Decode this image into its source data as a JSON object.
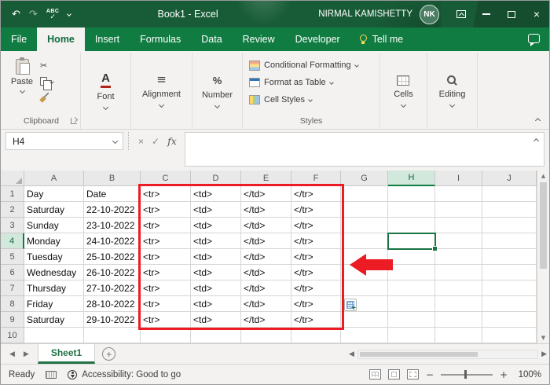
{
  "titlebar": {
    "title": "Book1 - Excel",
    "user_name": "NIRMAL KAMISHETTY",
    "user_initials": "NK"
  },
  "icons": {
    "undo": "↶",
    "redo": "↷",
    "spell_abc": "ABC",
    "check": "✓",
    "close": "×",
    "cancel": "×",
    "scissors": "✂",
    "font_a": "A",
    "align_lines": "≡",
    "percent": "%",
    "fx": "fx",
    "minus": "−",
    "plus": "+",
    "left": "◀",
    "right": "▶",
    "up": "▲",
    "down": "▼"
  },
  "tabs": {
    "items": [
      "File",
      "Home",
      "Insert",
      "Formulas",
      "Data",
      "Review",
      "Developer"
    ],
    "active": "Home",
    "tell_me": "Tell me"
  },
  "ribbon": {
    "paste_label": "Paste",
    "clipboard_label": "Clipboard",
    "font_label": "Font",
    "alignment_label": "Alignment",
    "number_label": "Number",
    "styles": {
      "conditional_formatting": "Conditional Formatting",
      "format_as_table": "Format as Table",
      "cell_styles": "Cell Styles",
      "label": "Styles"
    },
    "cells_label": "Cells",
    "editing_label": "Editing"
  },
  "formula_bar": {
    "name_box": "H4",
    "formula_value": ""
  },
  "grid": {
    "selected_cell": "H4",
    "selected_column": "H",
    "selected_row": "4",
    "column_headers": [
      "A",
      "B",
      "C",
      "D",
      "E",
      "F",
      "G",
      "H",
      "I",
      "J"
    ],
    "row_headers": [
      "1",
      "2",
      "3",
      "4",
      "5",
      "6",
      "7",
      "8",
      "9",
      "10"
    ],
    "rows": [
      [
        "Day",
        "Date",
        "<tr>",
        "<td>",
        "</td>",
        "</tr>"
      ],
      [
        "Saturday",
        "22-10-2022",
        "<tr>",
        "<td>",
        "</td>",
        "</tr>"
      ],
      [
        "Sunday",
        "23-10-2022",
        "<tr>",
        "<td>",
        "</td>",
        "</tr>"
      ],
      [
        "Monday",
        "24-10-2022",
        "<tr>",
        "<td>",
        "</td>",
        "</tr>"
      ],
      [
        "Tuesday",
        "25-10-2022",
        "<tr>",
        "<td>",
        "</td>",
        "</tr>"
      ],
      [
        "Wednesday",
        "26-10-2022",
        "<tr>",
        "<td>",
        "</td>",
        "</tr>"
      ],
      [
        "Thursday",
        "27-10-2022",
        "<tr>",
        "<td>",
        "</td>",
        "</tr>"
      ],
      [
        "Friday",
        "28-10-2022",
        "<tr>",
        "<td>",
        "</td>",
        "</tr>"
      ],
      [
        "Saturday",
        "29-10-2022",
        "<tr>",
        "<td>",
        "</td>",
        "</tr>"
      ]
    ]
  },
  "sheet_bar": {
    "sheet_name": "Sheet1"
  },
  "status_bar": {
    "mode": "Ready",
    "accessibility": "Accessibility: Good to go",
    "zoom": "100%"
  },
  "colors": {
    "titlebar_green": "#185C37",
    "ribbon_green": "#107C41",
    "accent_green": "#217346",
    "annotation_red": "#ED1C24"
  }
}
